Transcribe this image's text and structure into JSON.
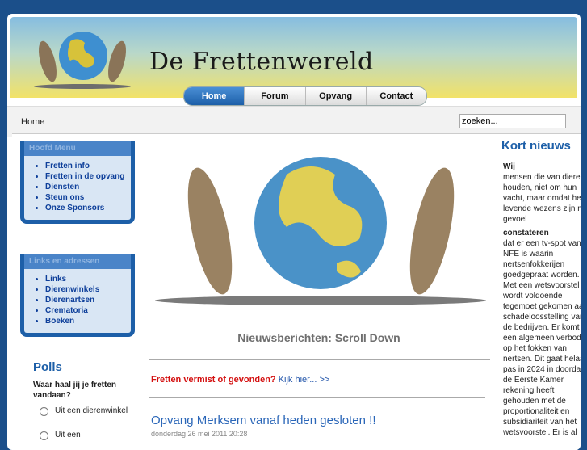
{
  "site": {
    "title": "De Frettenwereld"
  },
  "nav": {
    "items": [
      "Home",
      "Forum",
      "Opvang",
      "Contact"
    ],
    "active": "Home"
  },
  "breadcrumb": "Home",
  "search": {
    "value": "zoeken..."
  },
  "sidebar": {
    "menu1": {
      "title": "Hoofd Menu",
      "items": [
        "Fretten info",
        "Fretten in de opvang",
        "Diensten",
        "Steun ons",
        "Onze Sponsors"
      ]
    },
    "menu2": {
      "title": "Links en adressen",
      "items": [
        "Links",
        "Dierenwinkels",
        "Dierenartsen",
        "Crematoria",
        "Boeken"
      ]
    },
    "polls": {
      "title": "Polls",
      "question": "Waar haal jij je fretten vandaan?",
      "options": [
        "Uit een dierenwinkel",
        "Uit een"
      ]
    }
  },
  "main": {
    "scroll_text": "Nieuwsberichten: Scroll Down",
    "missing_red": "Fretten vermist of gevonden?",
    "missing_link": "Kijk hier... >>",
    "article": {
      "title": "Opvang Merksem vanaf heden gesloten !!",
      "date": "donderdag 26 mei 2011 20:28"
    }
  },
  "news": {
    "title": "Kort nieuws",
    "h1": "Wij",
    "p1": "mensen die van dieren houden, niet om hun vacht, maar omdat het levende wezens zijn met gevoel",
    "h2": "constateren",
    "p2": "dat er een tv-spot van NFE is waarin nertsenfokkerijen goedgepraat worden. Met een wetsvoorstel wordt voldoende tegemoet gekomen aan schadeloosstelling van de bedrijven. Er komt een algemeen verbod op het fokken van nertsen. Dit gaat helaas pas in 2024 in doordat de Eerste Kamer rekening heeft gehouden met de proportionaliteit en subsidiariteit van het wetsvoorstel. Er is al"
  },
  "colors": {
    "accent": "#1d5fa8",
    "missing_red": "#d41010"
  }
}
